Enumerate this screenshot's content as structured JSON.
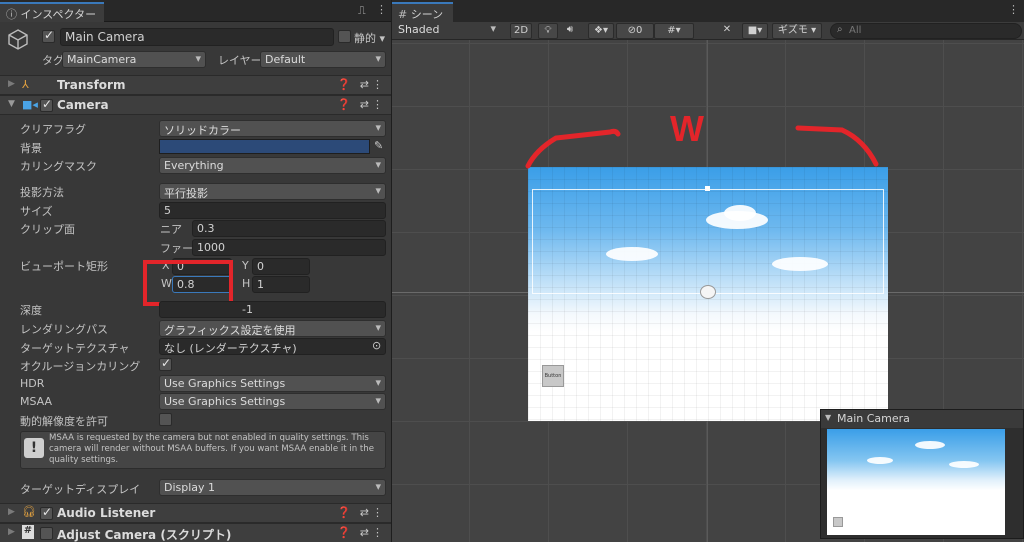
{
  "inspector": {
    "tab_label": "インスペクター",
    "object": {
      "name": "Main Camera",
      "static_label": "静的",
      "tag_label": "タグ",
      "tag_value": "MainCamera",
      "layer_label": "レイヤー",
      "layer_value": "Default"
    },
    "components": {
      "transform": "Transform",
      "camera": "Camera",
      "audio_listener": "Audio Listener",
      "adjust_camera": "Adjust Camera (スクリプト)"
    },
    "camera": {
      "clear_flags_label": "クリアフラグ",
      "clear_flags_value": "ソリッドカラー",
      "background_label": "背景",
      "background_color": "#2c4a78",
      "culling_mask_label": "カリングマスク",
      "culling_mask_value": "Everything",
      "projection_label": "投影方法",
      "projection_value": "平行投影",
      "size_label": "サイズ",
      "size_value": "5",
      "clip_label": "クリップ面",
      "near_label": "ニア",
      "near_value": "0.3",
      "far_label": "ファー",
      "far_value": "1000",
      "viewport_label": "ビューポート矩形",
      "x_label": "X",
      "x_value": "0",
      "y_label": "Y",
      "y_value": "0",
      "w_label": "W",
      "w_value": "0.8",
      "h_label": "H",
      "h_value": "1",
      "depth_label": "深度",
      "depth_value": "-1",
      "rendering_path_label": "レンダリングパス",
      "rendering_path_value": "グラフィックス設定を使用",
      "target_texture_label": "ターゲットテクスチャ",
      "target_texture_value": "なし (レンダーテクスチャ)",
      "occlusion_label": "オクルージョンカリング",
      "hdr_label": "HDR",
      "hdr_value": "Use Graphics Settings",
      "msaa_label": "MSAA",
      "msaa_value": "Use Graphics Settings",
      "dynamic_res_label": "動的解像度を許可",
      "warning": "MSAA is requested by the camera but not enabled in quality settings. This camera will render without MSAA buffers. If you want MSAA enable it in the quality settings.",
      "target_display_label": "ターゲットディスプレイ",
      "target_display_value": "Display 1"
    }
  },
  "scene": {
    "tab_label": "シーン",
    "shading": "Shaded",
    "mode_2d": "2D",
    "hidden_count": "0",
    "gizmos": "ギズモ",
    "search_placeholder": "All",
    "annotation": "W",
    "button_label": "Button",
    "preview_title": "Main Camera"
  },
  "colors": {
    "accent": "#3a79bb",
    "annotation_red": "#e3252a"
  }
}
